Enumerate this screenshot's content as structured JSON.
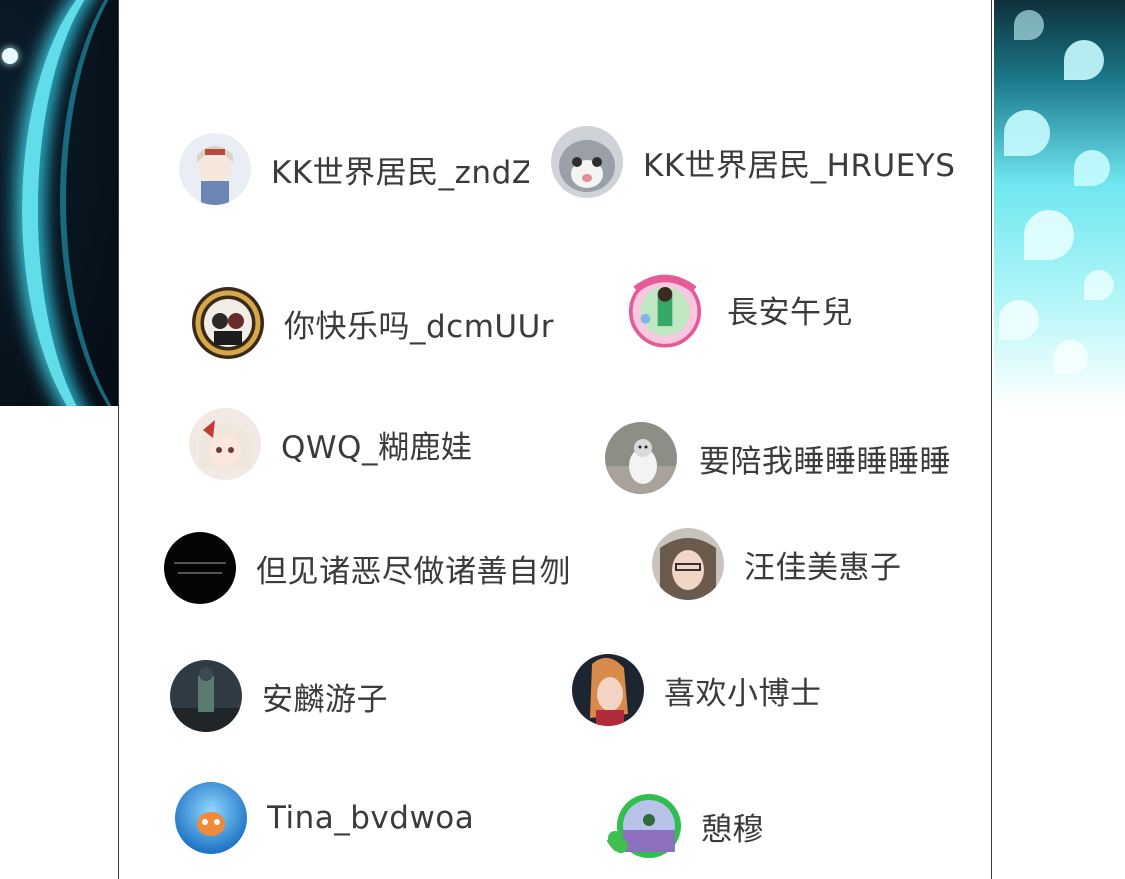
{
  "users": [
    {
      "name": "KK世界居民_zndZ",
      "avatar": "anime-boy-white-hair"
    },
    {
      "name": "KK世界居民_HRUEYS",
      "avatar": "grey-cat"
    },
    {
      "name": "你快乐吗_dcmUUr",
      "avatar": "anime-pair-dark-frame"
    },
    {
      "name": "長安午兒",
      "avatar": "birthday-frame-girl"
    },
    {
      "name": "QWQ_糊鹿娃",
      "avatar": "anime-girl-red-ribbon"
    },
    {
      "name": "要陪我睡睡睡睡睡",
      "avatar": "husky-dog"
    },
    {
      "name": "但见诸恶尽做诸善自刎",
      "avatar": "black-text-avatar"
    },
    {
      "name": "汪佳美惠子",
      "avatar": "girl-with-glasses"
    },
    {
      "name": "安麟游子",
      "avatar": "dark-anime-figure"
    },
    {
      "name": "喜欢小博士",
      "avatar": "anime-girl-dark-bg"
    },
    {
      "name": "Tina_bvdwoa",
      "avatar": "blue-sea-creature"
    },
    {
      "name": "憩穆",
      "avatar": "lavender-field-clover-frame"
    }
  ],
  "colors": {
    "name_text": "#3b3b3b",
    "panel_bg": "#ffffff",
    "left_glow": "#66e8f4",
    "right_flowers": "#a8f4f7"
  }
}
